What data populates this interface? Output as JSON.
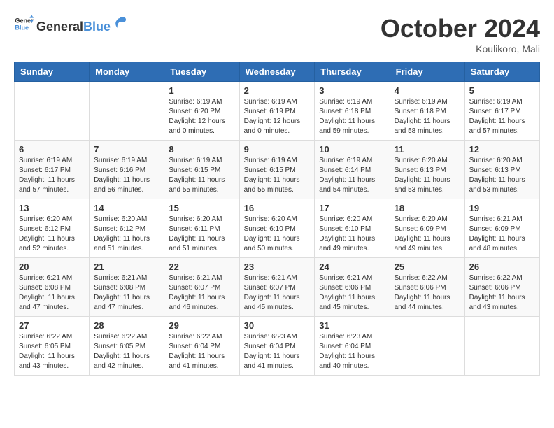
{
  "logo": {
    "general": "General",
    "blue": "Blue"
  },
  "title": "October 2024",
  "location": "Koulikoro, Mali",
  "days_header": [
    "Sunday",
    "Monday",
    "Tuesday",
    "Wednesday",
    "Thursday",
    "Friday",
    "Saturday"
  ],
  "weeks": [
    [
      {
        "day": "",
        "info": ""
      },
      {
        "day": "",
        "info": ""
      },
      {
        "day": "1",
        "info": "Sunrise: 6:19 AM\nSunset: 6:20 PM\nDaylight: 12 hours and 0 minutes."
      },
      {
        "day": "2",
        "info": "Sunrise: 6:19 AM\nSunset: 6:19 PM\nDaylight: 12 hours and 0 minutes."
      },
      {
        "day": "3",
        "info": "Sunrise: 6:19 AM\nSunset: 6:18 PM\nDaylight: 11 hours and 59 minutes."
      },
      {
        "day": "4",
        "info": "Sunrise: 6:19 AM\nSunset: 6:18 PM\nDaylight: 11 hours and 58 minutes."
      },
      {
        "day": "5",
        "info": "Sunrise: 6:19 AM\nSunset: 6:17 PM\nDaylight: 11 hours and 57 minutes."
      }
    ],
    [
      {
        "day": "6",
        "info": "Sunrise: 6:19 AM\nSunset: 6:17 PM\nDaylight: 11 hours and 57 minutes."
      },
      {
        "day": "7",
        "info": "Sunrise: 6:19 AM\nSunset: 6:16 PM\nDaylight: 11 hours and 56 minutes."
      },
      {
        "day": "8",
        "info": "Sunrise: 6:19 AM\nSunset: 6:15 PM\nDaylight: 11 hours and 55 minutes."
      },
      {
        "day": "9",
        "info": "Sunrise: 6:19 AM\nSunset: 6:15 PM\nDaylight: 11 hours and 55 minutes."
      },
      {
        "day": "10",
        "info": "Sunrise: 6:19 AM\nSunset: 6:14 PM\nDaylight: 11 hours and 54 minutes."
      },
      {
        "day": "11",
        "info": "Sunrise: 6:20 AM\nSunset: 6:13 PM\nDaylight: 11 hours and 53 minutes."
      },
      {
        "day": "12",
        "info": "Sunrise: 6:20 AM\nSunset: 6:13 PM\nDaylight: 11 hours and 53 minutes."
      }
    ],
    [
      {
        "day": "13",
        "info": "Sunrise: 6:20 AM\nSunset: 6:12 PM\nDaylight: 11 hours and 52 minutes."
      },
      {
        "day": "14",
        "info": "Sunrise: 6:20 AM\nSunset: 6:12 PM\nDaylight: 11 hours and 51 minutes."
      },
      {
        "day": "15",
        "info": "Sunrise: 6:20 AM\nSunset: 6:11 PM\nDaylight: 11 hours and 51 minutes."
      },
      {
        "day": "16",
        "info": "Sunrise: 6:20 AM\nSunset: 6:10 PM\nDaylight: 11 hours and 50 minutes."
      },
      {
        "day": "17",
        "info": "Sunrise: 6:20 AM\nSunset: 6:10 PM\nDaylight: 11 hours and 49 minutes."
      },
      {
        "day": "18",
        "info": "Sunrise: 6:20 AM\nSunset: 6:09 PM\nDaylight: 11 hours and 49 minutes."
      },
      {
        "day": "19",
        "info": "Sunrise: 6:21 AM\nSunset: 6:09 PM\nDaylight: 11 hours and 48 minutes."
      }
    ],
    [
      {
        "day": "20",
        "info": "Sunrise: 6:21 AM\nSunset: 6:08 PM\nDaylight: 11 hours and 47 minutes."
      },
      {
        "day": "21",
        "info": "Sunrise: 6:21 AM\nSunset: 6:08 PM\nDaylight: 11 hours and 47 minutes."
      },
      {
        "day": "22",
        "info": "Sunrise: 6:21 AM\nSunset: 6:07 PM\nDaylight: 11 hours and 46 minutes."
      },
      {
        "day": "23",
        "info": "Sunrise: 6:21 AM\nSunset: 6:07 PM\nDaylight: 11 hours and 45 minutes."
      },
      {
        "day": "24",
        "info": "Sunrise: 6:21 AM\nSunset: 6:06 PM\nDaylight: 11 hours and 45 minutes."
      },
      {
        "day": "25",
        "info": "Sunrise: 6:22 AM\nSunset: 6:06 PM\nDaylight: 11 hours and 44 minutes."
      },
      {
        "day": "26",
        "info": "Sunrise: 6:22 AM\nSunset: 6:06 PM\nDaylight: 11 hours and 43 minutes."
      }
    ],
    [
      {
        "day": "27",
        "info": "Sunrise: 6:22 AM\nSunset: 6:05 PM\nDaylight: 11 hours and 43 minutes."
      },
      {
        "day": "28",
        "info": "Sunrise: 6:22 AM\nSunset: 6:05 PM\nDaylight: 11 hours and 42 minutes."
      },
      {
        "day": "29",
        "info": "Sunrise: 6:22 AM\nSunset: 6:04 PM\nDaylight: 11 hours and 41 minutes."
      },
      {
        "day": "30",
        "info": "Sunrise: 6:23 AM\nSunset: 6:04 PM\nDaylight: 11 hours and 41 minutes."
      },
      {
        "day": "31",
        "info": "Sunrise: 6:23 AM\nSunset: 6:04 PM\nDaylight: 11 hours and 40 minutes."
      },
      {
        "day": "",
        "info": ""
      },
      {
        "day": "",
        "info": ""
      }
    ]
  ]
}
